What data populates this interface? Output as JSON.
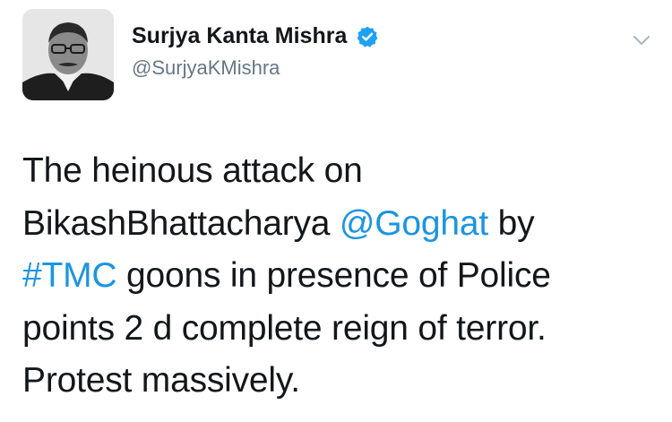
{
  "author": {
    "display_name": "Surjya Kanta Mishra",
    "handle": "@SurjyaKMishra",
    "verified": true
  },
  "icons": {
    "verified": "verified-badge-icon",
    "caret": "chevron-down-icon"
  },
  "colors": {
    "link": "#1b95e0",
    "verified": "#1da1f2",
    "handle": "#657786",
    "text": "#14171a"
  },
  "tweet": {
    "line1": "The heinous attack on",
    "line2_text": "BikashBhattacharya ",
    "mention": "@Goghat",
    "line2_suffix": " by",
    "hashtag": "#TMC",
    "line3_suffix": " goons in presence of Police",
    "line4": "points 2 d complete reign of terror.",
    "line5": "Protest massively."
  }
}
